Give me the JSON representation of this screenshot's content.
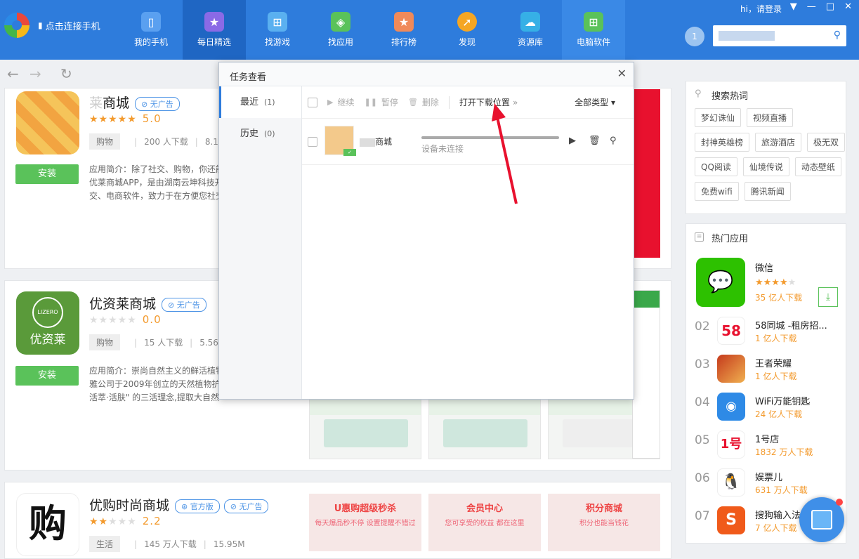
{
  "brand": {
    "connect_label": "点击连接手机"
  },
  "nav": {
    "tabs": [
      {
        "label": "我的手机",
        "icon": "phone-icon"
      },
      {
        "label": "每日精选",
        "icon": "calendar-star-icon"
      },
      {
        "label": "找游戏",
        "icon": "gamepad-icon"
      },
      {
        "label": "找应用",
        "icon": "app-bag-icon"
      },
      {
        "label": "排行榜",
        "icon": "ranking-icon"
      },
      {
        "label": "发现",
        "icon": "compass-icon"
      },
      {
        "label": "资源库",
        "icon": "cloud-icon"
      },
      {
        "label": "电脑软件",
        "icon": "windows-icon"
      }
    ]
  },
  "topright": {
    "login": "hi，请登录",
    "badge_count": "1"
  },
  "apps": [
    {
      "name": "商城",
      "name_prefix": "莱",
      "badges": [
        "无广告"
      ],
      "stars": 5,
      "score": "5.0",
      "category": "购物",
      "downloads": "200 人下载",
      "size": "8.18M",
      "install": "安装",
      "intro": "应用简介：除了社交、购物，你还能优莱商城APP，是由湖南云坤科技开交、电商软件，致力于在方便您社交"
    },
    {
      "name": "优资莱商城",
      "badges": [
        "无广告"
      ],
      "stars": 0,
      "score": "0.0",
      "category": "购物",
      "downloads": "15 人下载",
      "size": "5.56M",
      "install": "安装",
      "intro": "应用简介：崇尚自然主义的鲜活植物雅公司于2009年创立的天然植物护·活萃·活肤\" 的三活理念,提取大自然",
      "icon_text": "优资莱",
      "icon_sub": "LIZERO"
    },
    {
      "name": "优购时尚商城",
      "badges": [
        "官方版",
        "无广告"
      ],
      "stars": 2.5,
      "score": "2.2",
      "category": "生活",
      "downloads": "145 万人下载",
      "size": "15.95M",
      "icon_text": "购"
    }
  ],
  "promo": [
    {
      "title": "U惠购超级秒杀",
      "sub": "每天爆品秒不停 设置提醒不错过"
    },
    {
      "title": "会员中心",
      "sub": "您可享受的权益 都在这里"
    },
    {
      "title": "积分商城",
      "sub": "积分也能当钱花"
    }
  ],
  "sidebar": {
    "search_hot_title": "搜索热词",
    "tags": [
      "梦幻诛仙",
      "视频直播",
      "封神英雄榜",
      "旅游酒店",
      "极无双",
      "QQ阅读",
      "仙境传说",
      "动态壁纸",
      "免费wifi",
      "腾讯新闻"
    ],
    "hot_apps_title": "热门应用",
    "hot_apps": [
      {
        "rank": "",
        "name": "微信",
        "downloads": "35 亿人下载",
        "stars": 3.5,
        "color": "#2dc100"
      },
      {
        "rank": "02",
        "name": "58同城 -租房招...",
        "downloads": "1 亿人下载",
        "color": "#ffffff"
      },
      {
        "rank": "03",
        "name": "王者荣耀",
        "downloads": "1 亿人下载",
        "color": "#b0501f"
      },
      {
        "rank": "04",
        "name": "WiFi万能钥匙",
        "downloads": "24 亿人下载",
        "color": "#2e8ae6"
      },
      {
        "rank": "05",
        "name": "1号店",
        "downloads": "1832 万人下载",
        "color": "#ffffff"
      },
      {
        "rank": "06",
        "name": "娱票儿",
        "downloads": "631 万人下载",
        "color": "#ffffff"
      },
      {
        "rank": "07",
        "name": "搜狗输入法",
        "downloads": "7 亿人下载",
        "color": "#f05a1a"
      }
    ]
  },
  "dialog": {
    "title": "任务查看",
    "tabs": [
      {
        "label": "最近",
        "count": "(1)"
      },
      {
        "label": "历史",
        "count": "(0)"
      }
    ],
    "toolbar": {
      "resume": "继续",
      "pause": "暂停",
      "delete": "删除",
      "open_location": "打开下载位置",
      "all_types": "全部类型"
    },
    "task": {
      "name": "商城",
      "status": "设备未连接"
    }
  }
}
